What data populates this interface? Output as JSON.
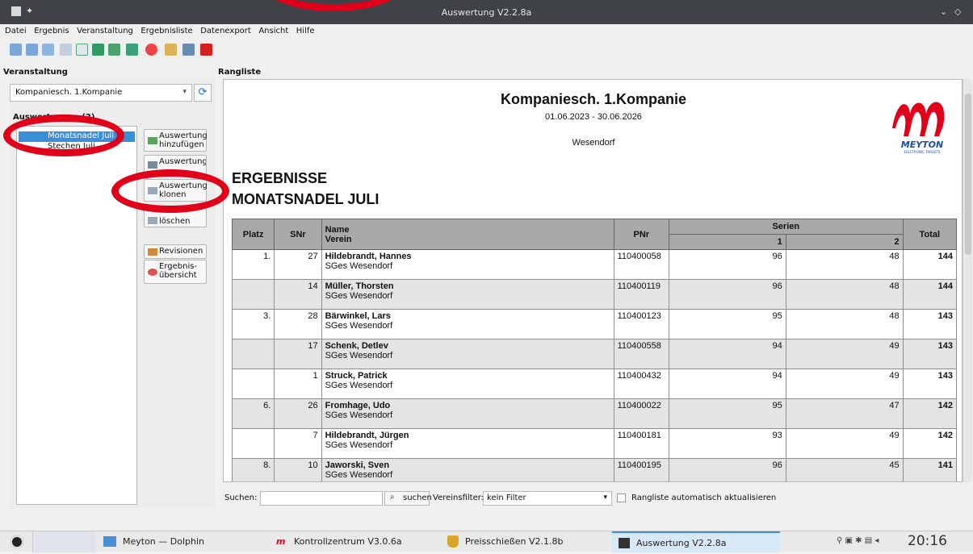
{
  "window": {
    "title": "Auswertung V2.2.8a"
  },
  "menu": [
    "Datei",
    "Ergebnis",
    "Veranstaltung",
    "Ergebnisliste",
    "Datenexport",
    "Ansicht",
    "Hilfe"
  ],
  "left": {
    "section_label": "Veranstaltung",
    "event_select": "Kompaniesch. 1.Kompanie",
    "group_label": "Auswertungen (2)",
    "items": [
      "Monatsnadel Juli",
      "Stechen Juli"
    ],
    "buttons": {
      "add": "Auswertung hinzufügen",
      "edit": "Auswertung",
      "clone": "Auswertung klonen",
      "delete": "löschen",
      "revisions": "Revisionen",
      "overview": "Ergebnis-übersicht"
    }
  },
  "right": {
    "section_label": "Rangliste",
    "report": {
      "title": "Kompaniesch. 1.Kompanie",
      "date_range": "01.06.2023 - 30.06.2026",
      "place": "Wesendorf",
      "heading1": "ERGEBNISSE",
      "heading2": "MONATSNADEL JULI",
      "logo_text": "MEYTON",
      "logo_sub": "ELECTRONIC TARGETS"
    },
    "table": {
      "headers": {
        "platz": "Platz",
        "snr": "SNr",
        "name": "Name",
        "verein": "Verein",
        "pnr": "PNr",
        "serien": "Serien",
        "s1": "1",
        "s2": "2",
        "total": "Total"
      },
      "rows": [
        {
          "platz": "1.",
          "snr": "27",
          "name": "Hildebrandt, Hannes",
          "verein": "SGes Wesendorf",
          "pnr": "110400058",
          "s1": "96",
          "s2": "48",
          "total": "144"
        },
        {
          "platz": "",
          "snr": "14",
          "name": "Müller, Thorsten",
          "verein": "SGes Wesendorf",
          "pnr": "110400119",
          "s1": "96",
          "s2": "48",
          "total": "144"
        },
        {
          "platz": "3.",
          "snr": "28",
          "name": "Bärwinkel, Lars",
          "verein": "SGes Wesendorf",
          "pnr": "110400123",
          "s1": "95",
          "s2": "48",
          "total": "143"
        },
        {
          "platz": "",
          "snr": "17",
          "name": "Schenk, Detlev",
          "verein": "SGes Wesendorf",
          "pnr": "110400558",
          "s1": "94",
          "s2": "49",
          "total": "143"
        },
        {
          "platz": "",
          "snr": "1",
          "name": "Struck, Patrick",
          "verein": "SGes Wesendorf",
          "pnr": "110400432",
          "s1": "94",
          "s2": "49",
          "total": "143"
        },
        {
          "platz": "6.",
          "snr": "26",
          "name": "Fromhage, Udo",
          "verein": "SGes Wesendorf",
          "pnr": "110400022",
          "s1": "95",
          "s2": "47",
          "total": "142"
        },
        {
          "platz": "",
          "snr": "7",
          "name": "Hildebrandt, Jürgen",
          "verein": "SGes Wesendorf",
          "pnr": "110400181",
          "s1": "93",
          "s2": "49",
          "total": "142"
        },
        {
          "platz": "8.",
          "snr": "10",
          "name": "Jaworski, Sven",
          "verein": "SGes Wesendorf",
          "pnr": "110400195",
          "s1": "96",
          "s2": "45",
          "total": "141"
        }
      ]
    },
    "search_label": "Suchen:",
    "search_value": "",
    "search_button": "suchen",
    "filter_label": "Vereinsfilter:",
    "filter_value": "kein Filter",
    "auto_update_label": "Rangliste automatisch aktualisieren"
  },
  "taskbar": {
    "tasks": [
      "Meyton — Dolphin",
      "Kontrollzentrum V3.0.6a",
      "Preisschießen V2.1.8b",
      "Auswertung V2.2.8a"
    ],
    "clock": "20:16"
  },
  "colors": {
    "accent": "#3b8fd9",
    "annotation_ring": "#e0001a",
    "logo_red": "#e0001a",
    "logo_blue": "#1c4fa3"
  }
}
